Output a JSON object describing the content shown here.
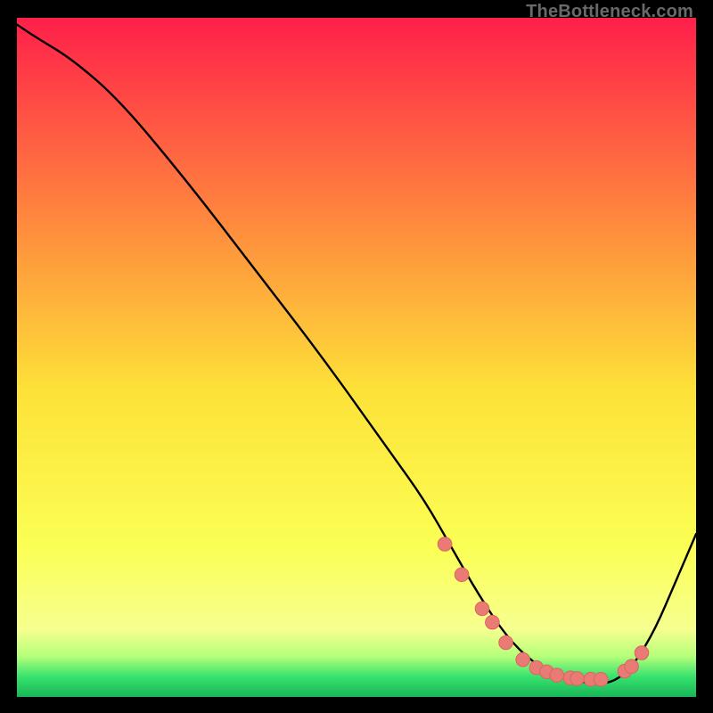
{
  "attribution": "TheBottleneck.com",
  "colors": {
    "gradient_top": "#ff1f4a",
    "gradient_mid_upper": "#ff823e",
    "gradient_mid": "#fde238",
    "gradient_lower": "#f6ff8f",
    "gradient_green1": "#b6ff7a",
    "gradient_green2": "#38e26e",
    "gradient_green3": "#18b657",
    "curve": "#000000",
    "marker_fill": "#e97a74",
    "marker_stroke": "#d96660"
  },
  "chart_data": {
    "type": "line",
    "title": "",
    "xlabel": "",
    "ylabel": "",
    "xlim": [
      0,
      100
    ],
    "ylim": [
      0,
      100
    ],
    "grid": false,
    "legend": false,
    "series": [
      {
        "name": "bottleneck-curve",
        "x": [
          0,
          3,
          8,
          15,
          25,
          35,
          45,
          55,
          60,
          64,
          68,
          72,
          76,
          80,
          84,
          87,
          89,
          91,
          94,
          97,
          100
        ],
        "y": [
          99,
          97,
          94,
          88,
          76,
          63,
          50,
          36,
          29,
          22,
          15,
          9,
          5,
          3,
          2,
          2,
          3,
          5,
          10,
          17,
          24
        ]
      }
    ],
    "markers": {
      "name": "highlighted-points",
      "x": [
        63,
        65.5,
        68.5,
        70,
        72,
        74.5,
        76.5,
        78,
        79.5,
        81.5,
        82.5,
        84.5,
        86,
        89.5,
        90.5,
        92
      ],
      "y": [
        22.5,
        18,
        13,
        11,
        8,
        5.5,
        4.3,
        3.7,
        3.2,
        2.8,
        2.7,
        2.6,
        2.6,
        3.8,
        4.5,
        6.5
      ]
    }
  }
}
